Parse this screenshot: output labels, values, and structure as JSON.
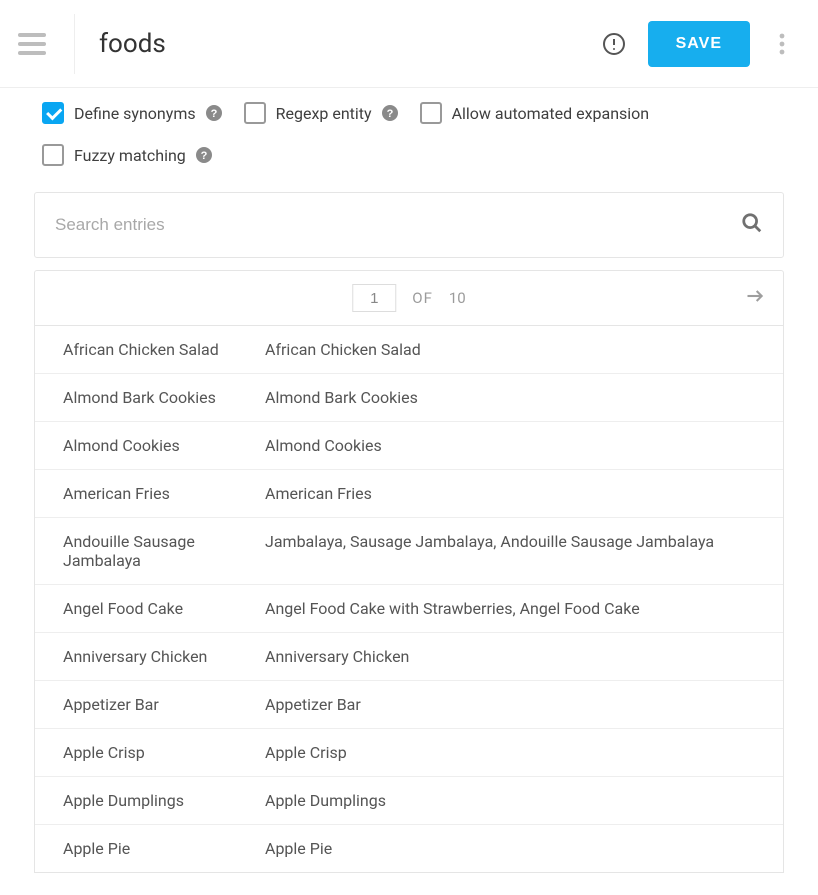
{
  "header": {
    "title": "foods",
    "save_label": "SAVE"
  },
  "options": {
    "define_synonyms": {
      "label": "Define synonyms",
      "checked": true
    },
    "regexp_entity": {
      "label": "Regexp entity",
      "checked": false
    },
    "allow_expansion": {
      "label": "Allow automated expansion",
      "checked": false
    },
    "fuzzy_matching": {
      "label": "Fuzzy matching",
      "checked": false
    }
  },
  "search": {
    "placeholder": "Search entries",
    "value": ""
  },
  "pager": {
    "current": "1",
    "of_label": "OF",
    "total": "10"
  },
  "entries": [
    {
      "term": "African Chicken Salad",
      "synonyms": "African Chicken Salad"
    },
    {
      "term": "Almond Bark Cookies",
      "synonyms": "Almond Bark Cookies"
    },
    {
      "term": "Almond Cookies",
      "synonyms": "Almond Cookies"
    },
    {
      "term": "American Fries",
      "synonyms": "American Fries"
    },
    {
      "term": "Andouille Sausage Jambalaya",
      "synonyms": "Jambalaya, Sausage Jambalaya, Andouille Sausage Jambalaya"
    },
    {
      "term": "Angel Food Cake",
      "synonyms": "Angel Food Cake with Strawberries, Angel Food Cake"
    },
    {
      "term": "Anniversary Chicken",
      "synonyms": "Anniversary Chicken"
    },
    {
      "term": "Appetizer Bar",
      "synonyms": "Appetizer Bar"
    },
    {
      "term": "Apple Crisp",
      "synonyms": "Apple Crisp"
    },
    {
      "term": "Apple Dumplings",
      "synonyms": "Apple Dumplings"
    },
    {
      "term": "Apple Pie",
      "synonyms": "Apple Pie"
    }
  ]
}
